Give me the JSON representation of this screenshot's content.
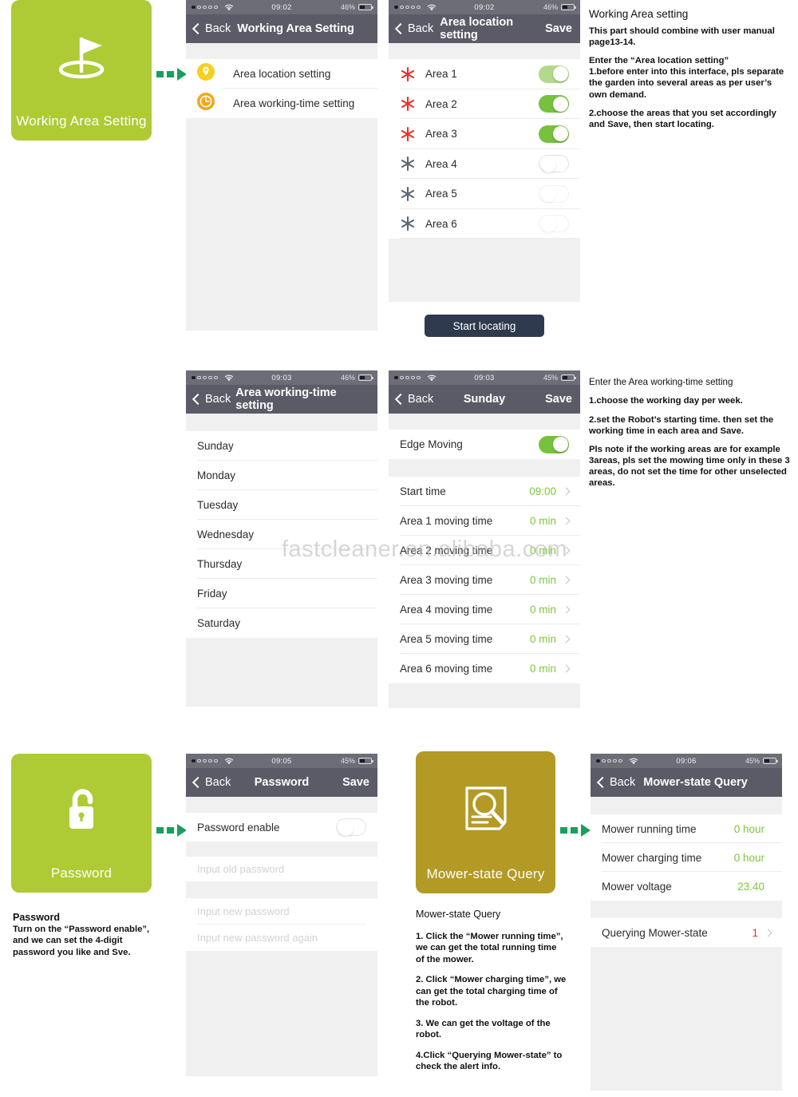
{
  "colors": {
    "tile_green": "#aecb35",
    "tile_olive": "#b39a24",
    "arrow_green": "#17a05c",
    "navbar": "#5b5b68",
    "statusbar": "#6d6d78",
    "value_green": "#7ec63f",
    "value_red": "#e03127",
    "button_dark": "#2f3a4f",
    "pin_yellow": "#f5d020",
    "clock_orange": "#f0a81e",
    "asterisk_red": "#e8322a",
    "asterisk_gray": "#5c6670"
  },
  "watermark": {
    "left": "fastcleaner.",
    "right": "en.alibaba.com",
    "full": "fastcleaner.en.alibaba.com"
  },
  "sections": {
    "working_area": {
      "tile_label": "Working Area Setting",
      "tile_icon": "flag-on-green-icon",
      "phone1": {
        "status": {
          "time": "09:02",
          "battery": "46%",
          "signal_dots": 1,
          "wifi": "wifi-icon"
        },
        "nav": {
          "back": "Back",
          "title": "Working Area Setting"
        },
        "rows": [
          {
            "icon": "map-pin-icon",
            "label": "Area location setting"
          },
          {
            "icon": "clock-icon",
            "label": "Area working-time setting"
          }
        ]
      },
      "phone2": {
        "status": {
          "time": "09:02",
          "battery": "46%",
          "signal_dots": 1,
          "wifi": "wifi-icon"
        },
        "nav": {
          "back": "Back",
          "title": "Area location setting",
          "save": "Save"
        },
        "areas": [
          {
            "label": "Area 1",
            "on": true,
            "pale": true,
            "marker": "red"
          },
          {
            "label": "Area 2",
            "on": true,
            "pale": false,
            "marker": "red"
          },
          {
            "label": "Area 3",
            "on": true,
            "pale": false,
            "marker": "red"
          },
          {
            "label": "Area 4",
            "on": false,
            "pale": false,
            "marker": "gray"
          },
          {
            "label": "Area 5",
            "on": false,
            "pale": true,
            "marker": "gray"
          },
          {
            "label": "Area 6",
            "on": false,
            "pale": true,
            "marker": "gray"
          }
        ],
        "button": "Start locating"
      },
      "desc": {
        "title": "Working Area setting",
        "p1": "This part should combine with user manual page13-14.",
        "p2": "Enter the “Area location setting”\n1.before enter into this interface, pls separate the garden into several areas as per user’s own demand.",
        "p3": "2.choose the areas that you set accordingly and Save, then start locating."
      }
    },
    "working_time": {
      "phone1": {
        "status": {
          "time": "09:03",
          "battery": "46%",
          "signal_dots": 1,
          "wifi": "wifi-icon"
        },
        "nav": {
          "back": "Back",
          "title": "Area working-time setting"
        },
        "days": [
          "Sunday",
          "Monday",
          "Tuesday",
          "Wednesday",
          "Thursday",
          "Friday",
          "Saturday"
        ]
      },
      "phone2": {
        "status": {
          "time": "09:03",
          "battery": "45%",
          "signal_dots": 1,
          "wifi": "wifi-icon"
        },
        "nav": {
          "back": "Back",
          "title": "Sunday",
          "save": "Save"
        },
        "edge_moving": {
          "label": "Edge Moving",
          "on": true
        },
        "items": [
          {
            "label": "Start time",
            "value": "09:00",
            "chevron": true
          },
          {
            "label": "Area 1 moving time",
            "value": "0 min",
            "chevron": true
          },
          {
            "label": "Area 2 moving time",
            "value": "0 min",
            "chevron": true
          },
          {
            "label": "Area 3 moving time",
            "value": "0 min",
            "chevron": true
          },
          {
            "label": "Area 4 moving time",
            "value": "0 min",
            "chevron": true
          },
          {
            "label": "Area 5 moving time",
            "value": "0 min",
            "chevron": true
          },
          {
            "label": "Area 6 moving time",
            "value": "0 min",
            "chevron": true
          }
        ]
      },
      "desc": {
        "p0": "Enter the Area working-time setting",
        "p1": "1.choose the working day per week.",
        "p2": "2.set the Robot’s starting time. then set the working time in each area and Save.",
        "p3": "Pls note if  the working areas are for example 3areas, pls set the mowing time only in these 3 areas, do not set the time for other unselected areas."
      }
    },
    "password": {
      "tile_label": "Password",
      "tile_icon": "open-padlock-icon",
      "caption_title": "Password",
      "caption_body": "Turn on the “Password enable”,\n and we can set the 4-digit\npassword you like and Sve.",
      "phone": {
        "status": {
          "time": "09:05",
          "battery": "45%",
          "signal_dots": 1,
          "wifi": "wifi-icon"
        },
        "nav": {
          "back": "Back",
          "title": "Password",
          "save": "Save"
        },
        "enable": {
          "label": "Password enable",
          "on": false
        },
        "fields": [
          {
            "placeholder": "Input old password"
          },
          {
            "placeholder": "Input new password"
          },
          {
            "placeholder": "Input new password again"
          }
        ]
      }
    },
    "mower_state": {
      "tile_label": "Mower-state Query",
      "tile_icon": "document-magnifier-icon",
      "caption_title": "Mower-state Query",
      "caption_items": [
        "1. Click the “Mower running time”, we can get the total running time of the mower.",
        "2. Click “Mower charging time”, we can get the total charging time of the robot.",
        "3. We can get the voltage of the robot.",
        "4.Click “Querying Mower-state” to check the alert info."
      ],
      "phone": {
        "status": {
          "time": "09:06",
          "battery": "45%",
          "signal_dots": 1,
          "wifi": "wifi-icon"
        },
        "nav": {
          "back": "Back",
          "title": "Mower-state Query"
        },
        "items": [
          {
            "label": "Mower running time",
            "value": "0  hour",
            "red": false,
            "chevron": false
          },
          {
            "label": "Mower charging time",
            "value": "0  hour",
            "red": false,
            "chevron": false
          },
          {
            "label": "Mower voltage",
            "value": "23.40",
            "red": false,
            "chevron": false
          }
        ],
        "query": {
          "label": "Querying Mower-state",
          "value": "1",
          "red": true,
          "chevron": true
        }
      }
    }
  }
}
